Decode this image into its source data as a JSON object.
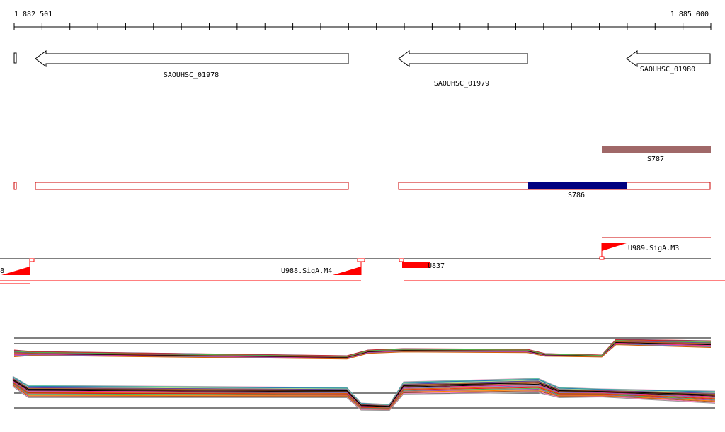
{
  "ruler": {
    "start_label": "1 882 501",
    "end_label": "1 885 000"
  },
  "genes": [
    {
      "name": "SAOUHSC_01978"
    },
    {
      "name": "SAOUHSC_01979"
    },
    {
      "name": "SAOUHSC_01980"
    }
  ],
  "features": [
    {
      "name": "S787",
      "color": "#a06868"
    },
    {
      "name": "S786",
      "color": "#000080"
    }
  ],
  "signals": [
    {
      "name": "U989.SigA.M3"
    },
    {
      "name": "U988.SigA.M4"
    },
    {
      "name": "U837"
    }
  ],
  "colors": {
    "outline": "#cc0000",
    "signal": "#ff0000",
    "axis": "#000000"
  }
}
